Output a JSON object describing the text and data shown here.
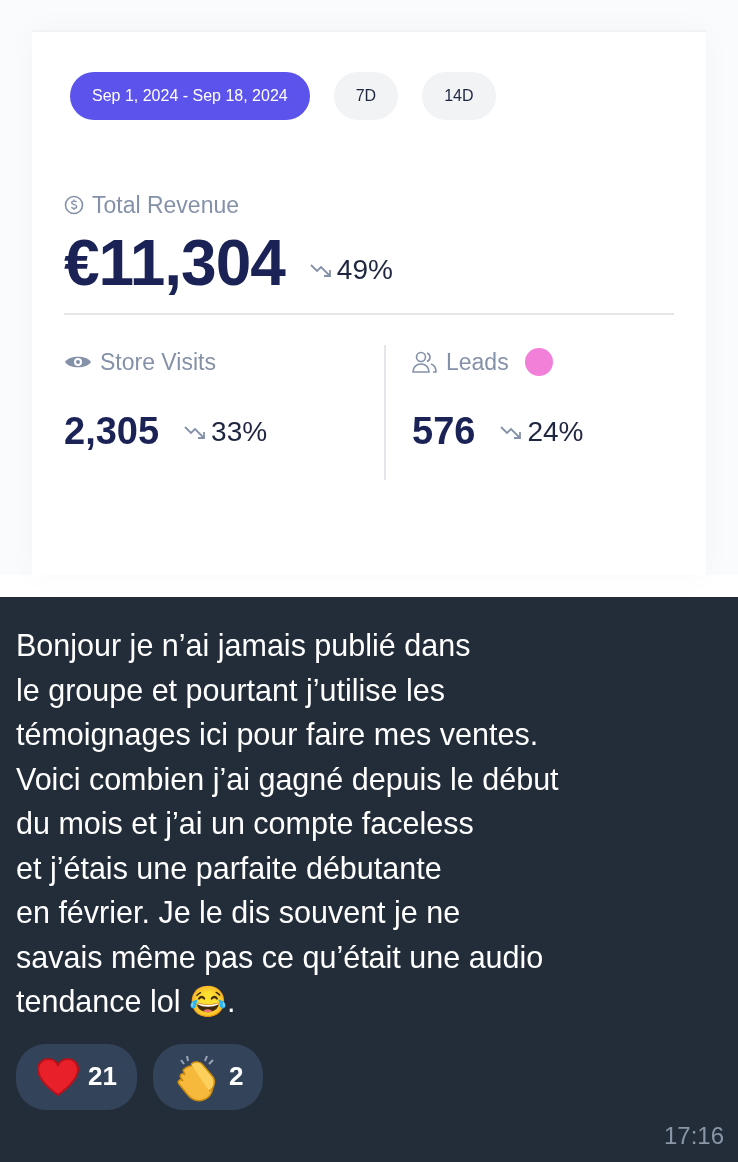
{
  "date_ranges": [
    {
      "label": "Sep 1, 2024 - Sep 18, 2024",
      "selected": true
    },
    {
      "label": "7D",
      "selected": false
    },
    {
      "label": "14D",
      "selected": false
    }
  ],
  "revenue": {
    "label": "Total Revenue",
    "value": "€11,304",
    "change": "49%"
  },
  "metrics": [
    {
      "kind": "visits",
      "label": "Store Visits",
      "value": "2,305",
      "change": "33%"
    },
    {
      "kind": "leads",
      "label": "Leads",
      "value": "576",
      "change": "24%",
      "color": "#f27fd8"
    }
  ],
  "message": {
    "text": "Bonjour je n’ai jamais publié dans\nle groupe et pourtant j’utilise les\ntémoignages ici pour faire mes ventes.\nVoici combien j’ai gagné depuis le début\ndu mois et j’ai un compte faceless\net j’étais une parfaite débutante\nen février. Je le dis souvent je ne\nsavais même pas ce qu’était une audio\ntendance lol 😂.",
    "reactions": [
      {
        "kind": "heart",
        "count": "21"
      },
      {
        "kind": "clap",
        "count": "2"
      }
    ],
    "time": "17:16"
  }
}
